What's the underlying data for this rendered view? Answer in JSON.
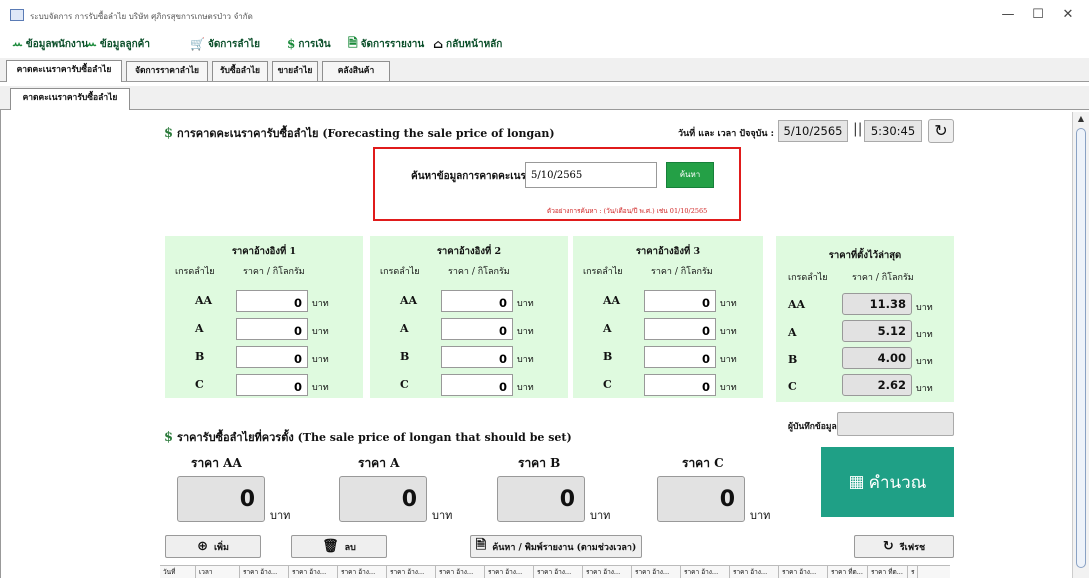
{
  "window": {
    "title": "ระบบจัดการ การรับซื้อลำไย บริษัท ศุภิกรสุขการเกษตรป่าว จำกัด",
    "controls": [
      "—",
      "☐",
      "✕"
    ]
  },
  "menu": [
    {
      "icon": "users-icon",
      "glyph": "ꕀ",
      "label": "ข้อมูลพนักงาน"
    },
    {
      "icon": "customers-icon",
      "glyph": "ꕀ",
      "label": "ข้อมูลลูกค้า"
    },
    {
      "icon": "cart-icon",
      "glyph": "🛒",
      "label": "จัดการลำไย"
    },
    {
      "icon": "dollar-icon",
      "glyph": "$",
      "label": "การเงิน"
    },
    {
      "icon": "report-icon",
      "glyph": "🗎",
      "label": "จัดการรายงาน"
    },
    {
      "icon": "home-icon",
      "glyph": "⌂",
      "label": "กลับหน้าหลัก"
    }
  ],
  "tabs": [
    "คาดคะเนราคารับซื้อลำไย",
    "จัดการราคาลำไย",
    "รับซื้อลำไย",
    "ขายลำไย",
    "คลังสินค้า"
  ],
  "subtab": "คาดคะเนราคารับซื้อลำไย",
  "forecast": {
    "dollar": "$",
    "heading": "การคาดคะเนราคารับซื้อลำไย (Forecasting the sale price of longan)",
    "clock_label": "วันที่ และ เวลา ปัจจุบัน :",
    "date": "5/10/2565",
    "separator": "||",
    "time": "5:30:45",
    "refresh_glyph": "↻"
  },
  "search": {
    "label": "ค้นหาข้อมูลการคาดคะเนราคา   วันที่ :",
    "value": "5/10/2565",
    "button": "ค้นหา",
    "hint": "ตัวอย่างการค้นหา : (วัน/เดือน/ปี พ.ศ.) เช่น 01/10/2565"
  },
  "ref_columns_header": {
    "grade": "เกรดลำไย",
    "price": "ราคา / กิโลกรัม"
  },
  "unit": "บาท",
  "reference_prices": [
    {
      "title": "ราคาอ้างอิงที่ 1",
      "rows": [
        {
          "grade": "AA",
          "value": "0"
        },
        {
          "grade": "A",
          "value": "0"
        },
        {
          "grade": "B",
          "value": "0"
        },
        {
          "grade": "C",
          "value": "0"
        }
      ]
    },
    {
      "title": "ราคาอ้างอิงที่ 2",
      "rows": [
        {
          "grade": "AA",
          "value": "0"
        },
        {
          "grade": "A",
          "value": "0"
        },
        {
          "grade": "B",
          "value": "0"
        },
        {
          "grade": "C",
          "value": "0"
        }
      ]
    },
    {
      "title": "ราคาอ้างอิงที่ 3",
      "rows": [
        {
          "grade": "AA",
          "value": "0"
        },
        {
          "grade": "A",
          "value": "0"
        },
        {
          "grade": "B",
          "value": "0"
        },
        {
          "grade": "C",
          "value": "0"
        }
      ]
    },
    {
      "title": "ราคาที่ตั้งไว้ล่าสุด",
      "rows": [
        {
          "grade": "AA",
          "value": "11.38"
        },
        {
          "grade": "A",
          "value": "5.12"
        },
        {
          "grade": "B",
          "value": "4.00"
        },
        {
          "grade": "C",
          "value": "2.62"
        }
      ]
    }
  ],
  "should_set": {
    "dollar": "$",
    "heading": "ราคารับซื้อลำไยที่ควรตั้ง (The sale price of longan that should be set)",
    "recorder_label": "ผู้บันทึกข้อมูล :",
    "recorder_value": "",
    "prices": [
      {
        "label": "ราคา AA",
        "value": "0"
      },
      {
        "label": "ราคา A",
        "value": "0"
      },
      {
        "label": "ราคา B",
        "value": "0"
      },
      {
        "label": "ราคา C",
        "value": "0"
      }
    ],
    "calculate_button": "คำนวณ",
    "calculate_glyph": "▦"
  },
  "buttons": {
    "add": "เพิ่ม",
    "delete": "ลบ",
    "search_print": "ค้นหา / พิมพ์รายงาน (ตามช่วงเวลา)",
    "refresh": "รีเฟรช",
    "add_glyph": "⊕",
    "delete_glyph": "🗑",
    "search_print_glyph": "🗎",
    "refresh_glyph": "↻"
  },
  "table": {
    "headers": [
      "วันที่",
      "เวลา",
      "ราคา อ้าง...",
      "ราคา อ้าง...",
      "ราคา อ้าง...",
      "ราคา อ้าง...",
      "ราคา อ้าง...",
      "ราคา อ้าง...",
      "ราคา อ้าง...",
      "ราคา อ้าง...",
      "ราคา อ้าง...",
      "ราคา อ้าง...",
      "ราคา อ้าง...",
      "ราคา อ้าง...",
      "ราคา ที่ต...",
      "ราคา ที่ต...",
      "ร"
    ]
  }
}
